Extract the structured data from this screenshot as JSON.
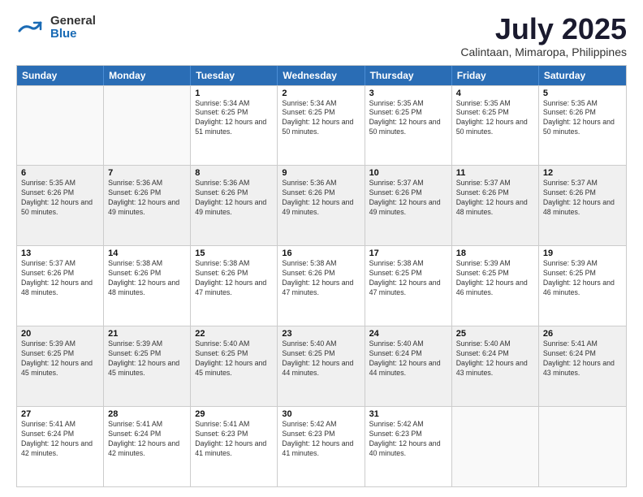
{
  "header": {
    "logo_general": "General",
    "logo_blue": "Blue",
    "main_title": "July 2025",
    "subtitle": "Calintaan, Mimaropa, Philippines"
  },
  "calendar": {
    "days": [
      "Sunday",
      "Monday",
      "Tuesday",
      "Wednesday",
      "Thursday",
      "Friday",
      "Saturday"
    ],
    "weeks": [
      [
        {
          "day": "",
          "info": ""
        },
        {
          "day": "",
          "info": ""
        },
        {
          "day": "1",
          "info": "Sunrise: 5:34 AM\nSunset: 6:25 PM\nDaylight: 12 hours and 51 minutes."
        },
        {
          "day": "2",
          "info": "Sunrise: 5:34 AM\nSunset: 6:25 PM\nDaylight: 12 hours and 50 minutes."
        },
        {
          "day": "3",
          "info": "Sunrise: 5:35 AM\nSunset: 6:25 PM\nDaylight: 12 hours and 50 minutes."
        },
        {
          "day": "4",
          "info": "Sunrise: 5:35 AM\nSunset: 6:25 PM\nDaylight: 12 hours and 50 minutes."
        },
        {
          "day": "5",
          "info": "Sunrise: 5:35 AM\nSunset: 6:26 PM\nDaylight: 12 hours and 50 minutes."
        }
      ],
      [
        {
          "day": "6",
          "info": "Sunrise: 5:35 AM\nSunset: 6:26 PM\nDaylight: 12 hours and 50 minutes."
        },
        {
          "day": "7",
          "info": "Sunrise: 5:36 AM\nSunset: 6:26 PM\nDaylight: 12 hours and 49 minutes."
        },
        {
          "day": "8",
          "info": "Sunrise: 5:36 AM\nSunset: 6:26 PM\nDaylight: 12 hours and 49 minutes."
        },
        {
          "day": "9",
          "info": "Sunrise: 5:36 AM\nSunset: 6:26 PM\nDaylight: 12 hours and 49 minutes."
        },
        {
          "day": "10",
          "info": "Sunrise: 5:37 AM\nSunset: 6:26 PM\nDaylight: 12 hours and 49 minutes."
        },
        {
          "day": "11",
          "info": "Sunrise: 5:37 AM\nSunset: 6:26 PM\nDaylight: 12 hours and 48 minutes."
        },
        {
          "day": "12",
          "info": "Sunrise: 5:37 AM\nSunset: 6:26 PM\nDaylight: 12 hours and 48 minutes."
        }
      ],
      [
        {
          "day": "13",
          "info": "Sunrise: 5:37 AM\nSunset: 6:26 PM\nDaylight: 12 hours and 48 minutes."
        },
        {
          "day": "14",
          "info": "Sunrise: 5:38 AM\nSunset: 6:26 PM\nDaylight: 12 hours and 48 minutes."
        },
        {
          "day": "15",
          "info": "Sunrise: 5:38 AM\nSunset: 6:26 PM\nDaylight: 12 hours and 47 minutes."
        },
        {
          "day": "16",
          "info": "Sunrise: 5:38 AM\nSunset: 6:26 PM\nDaylight: 12 hours and 47 minutes."
        },
        {
          "day": "17",
          "info": "Sunrise: 5:38 AM\nSunset: 6:25 PM\nDaylight: 12 hours and 47 minutes."
        },
        {
          "day": "18",
          "info": "Sunrise: 5:39 AM\nSunset: 6:25 PM\nDaylight: 12 hours and 46 minutes."
        },
        {
          "day": "19",
          "info": "Sunrise: 5:39 AM\nSunset: 6:25 PM\nDaylight: 12 hours and 46 minutes."
        }
      ],
      [
        {
          "day": "20",
          "info": "Sunrise: 5:39 AM\nSunset: 6:25 PM\nDaylight: 12 hours and 45 minutes."
        },
        {
          "day": "21",
          "info": "Sunrise: 5:39 AM\nSunset: 6:25 PM\nDaylight: 12 hours and 45 minutes."
        },
        {
          "day": "22",
          "info": "Sunrise: 5:40 AM\nSunset: 6:25 PM\nDaylight: 12 hours and 45 minutes."
        },
        {
          "day": "23",
          "info": "Sunrise: 5:40 AM\nSunset: 6:25 PM\nDaylight: 12 hours and 44 minutes."
        },
        {
          "day": "24",
          "info": "Sunrise: 5:40 AM\nSunset: 6:24 PM\nDaylight: 12 hours and 44 minutes."
        },
        {
          "day": "25",
          "info": "Sunrise: 5:40 AM\nSunset: 6:24 PM\nDaylight: 12 hours and 43 minutes."
        },
        {
          "day": "26",
          "info": "Sunrise: 5:41 AM\nSunset: 6:24 PM\nDaylight: 12 hours and 43 minutes."
        }
      ],
      [
        {
          "day": "27",
          "info": "Sunrise: 5:41 AM\nSunset: 6:24 PM\nDaylight: 12 hours and 42 minutes."
        },
        {
          "day": "28",
          "info": "Sunrise: 5:41 AM\nSunset: 6:24 PM\nDaylight: 12 hours and 42 minutes."
        },
        {
          "day": "29",
          "info": "Sunrise: 5:41 AM\nSunset: 6:23 PM\nDaylight: 12 hours and 41 minutes."
        },
        {
          "day": "30",
          "info": "Sunrise: 5:42 AM\nSunset: 6:23 PM\nDaylight: 12 hours and 41 minutes."
        },
        {
          "day": "31",
          "info": "Sunrise: 5:42 AM\nSunset: 6:23 PM\nDaylight: 12 hours and 40 minutes."
        },
        {
          "day": "",
          "info": ""
        },
        {
          "day": "",
          "info": ""
        }
      ]
    ]
  }
}
